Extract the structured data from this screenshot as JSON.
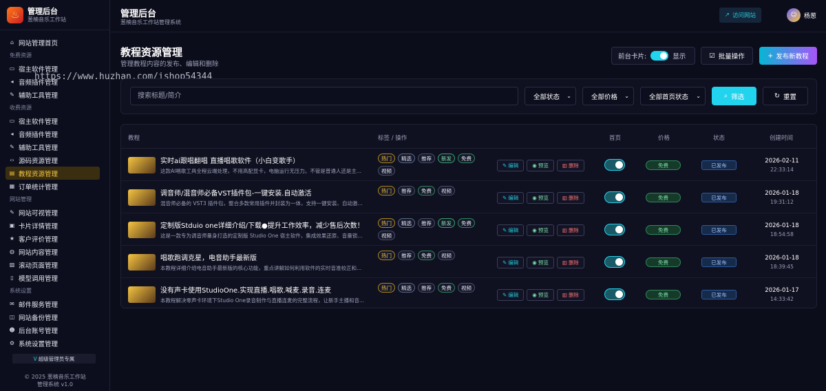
{
  "brand": {
    "title": "管理后台",
    "subtitle": "葱楠音乐工作站"
  },
  "nav": [
    {
      "type": "item",
      "label": "网站管理首页",
      "icon": "dashboard-icon",
      "glyph": "⌂"
    },
    {
      "type": "group",
      "label": "免费资源"
    },
    {
      "type": "item",
      "label": "宿主软件管理",
      "icon": "monitor-icon",
      "glyph": "▭"
    },
    {
      "type": "item",
      "label": "音频插件管理",
      "icon": "volume-icon",
      "glyph": "◂"
    },
    {
      "type": "item",
      "label": "辅助工具管理",
      "icon": "wrench-icon",
      "glyph": "✎"
    },
    {
      "type": "group",
      "label": "收费资源"
    },
    {
      "type": "item",
      "label": "宿主软件管理",
      "icon": "monitor-icon",
      "glyph": "▭"
    },
    {
      "type": "item",
      "label": "音频插件管理",
      "icon": "volume-icon",
      "glyph": "◂"
    },
    {
      "type": "item",
      "label": "辅助工具管理",
      "icon": "wrench-icon",
      "glyph": "✎"
    },
    {
      "type": "item",
      "label": "源码资源管理",
      "icon": "code-icon",
      "glyph": "‹›"
    },
    {
      "type": "item",
      "label": "教程资源管理",
      "icon": "folder-icon",
      "glyph": "▤",
      "active": true
    },
    {
      "type": "item",
      "label": "订单统计管理",
      "icon": "cart-icon",
      "glyph": "▦"
    },
    {
      "type": "group",
      "label": "网站管理"
    },
    {
      "type": "item",
      "label": "网站可视管理",
      "icon": "edit-icon",
      "glyph": "✎"
    },
    {
      "type": "item",
      "label": "卡片详情管理",
      "icon": "card-icon",
      "glyph": "▣"
    },
    {
      "type": "item",
      "label": "客户评价管理",
      "icon": "star-icon",
      "glyph": "★"
    },
    {
      "type": "item",
      "label": "网站内容管理",
      "icon": "globe-icon",
      "glyph": "◍"
    },
    {
      "type": "item",
      "label": "滚动页面管理",
      "icon": "image-icon",
      "glyph": "▨"
    },
    {
      "type": "item",
      "label": "模型调用管理",
      "icon": "file-icon",
      "glyph": "▯"
    },
    {
      "type": "group",
      "label": "系统设置"
    },
    {
      "type": "item",
      "label": "邮件服务管理",
      "icon": "mail-icon",
      "glyph": "✉"
    },
    {
      "type": "item",
      "label": "网站备份管理",
      "icon": "database-icon",
      "glyph": "◫"
    },
    {
      "type": "item",
      "label": "后台账号管理",
      "icon": "users-icon",
      "glyph": "☻"
    },
    {
      "type": "item",
      "label": "系统设置管理",
      "icon": "gear-icon",
      "glyph": "⚙"
    }
  ],
  "vip_label": "超级管理员专属",
  "footer": {
    "line1": "© 2025 葱楠音乐工作站",
    "line2": "管理系统 v1.0"
  },
  "topbar": {
    "title": "管理后台",
    "subtitle": "葱楠音乐工作站管理系统",
    "visit": "访问网站",
    "user": "杨葱"
  },
  "page": {
    "title": "教程资源管理",
    "subtitle": "管理教程内容的发布、编辑和删除"
  },
  "watermark": "https://www.huzhan.com/ishop54344",
  "controls": {
    "card_label": "前台卡片:",
    "card_state": "显示",
    "batch": "批量操作",
    "publish": "发布新教程"
  },
  "filter": {
    "search_placeholder": "搜索标题/简介",
    "status": "全部状态",
    "price": "全部价格",
    "home": "全部首页状态",
    "search_btn": "筛选",
    "reset": "重置"
  },
  "table": {
    "headers": {
      "tutorial": "教程",
      "tags": "标签 / 操作",
      "home": "首页",
      "price": "价格",
      "status": "状态",
      "created": "创建时间"
    },
    "action_labels": {
      "edit": "编辑",
      "view": "预览",
      "del": "删除"
    },
    "rows": [
      {
        "title": "实时ai跟唱翻唱 直播唱歌软件（小白变歌手）",
        "desc": "这款AI唱歌工具全程云端处理，不用高配显卡，电脑运行无压力。不管是普通人还是主...",
        "tags": [
          "热门",
          "精选",
          "推荐",
          "新发",
          "免费",
          "视频"
        ],
        "home_on": true,
        "price": "免费",
        "status": "已发布",
        "date": "2026-02-11",
        "time": "22:33:14"
      },
      {
        "title": "调音师/混音师必备VST插件包-一键安装.自动激活",
        "desc": "混音师必备的 VST3 插件包，整合多款常用插件并封装为一体，支持一键安装、自动激...",
        "tags": [
          "热门",
          "推荐",
          "免费",
          "视频"
        ],
        "home_on": true,
        "price": "免费",
        "status": "已发布",
        "date": "2026-01-18",
        "time": "19:31:12"
      },
      {
        "title": "定制版Stduio one详细介绍/下载●提升工作效率，减少售后次数！",
        "desc": "这是一款专为调音师量身打造的定制版 Studio One 宿主软件，集成效果还原、音量锁...",
        "tags": [
          "热门",
          "精选",
          "推荐",
          "新发",
          "免费",
          "视频"
        ],
        "home_on": true,
        "price": "免费",
        "status": "已发布",
        "date": "2026-01-18",
        "time": "18:54:58"
      },
      {
        "title": "唱歌跑调克星，电音助手最新版",
        "desc": "本教程详细介绍电音助手最新版的核心功能，重点讲解如何利用软件的实时音准校正和...",
        "tags": [
          "热门",
          "推荐",
          "免费",
          "视频"
        ],
        "home_on": true,
        "price": "免费",
        "status": "已发布",
        "date": "2026-01-18",
        "time": "18:39:45"
      },
      {
        "title": "没有声卡使用StudioOne.实现直播.唱歌.喊麦.录音.连麦",
        "desc": "本教程解决零声卡环境下Studio One录音制作与直播连麦的完整流程，让新手主播和音...",
        "tags": [
          "热门",
          "精选",
          "推荐",
          "免费",
          "视频"
        ],
        "home_on": true,
        "price": "免费",
        "status": "已发布",
        "date": "2026-01-17",
        "time": "14:33:42"
      }
    ]
  }
}
